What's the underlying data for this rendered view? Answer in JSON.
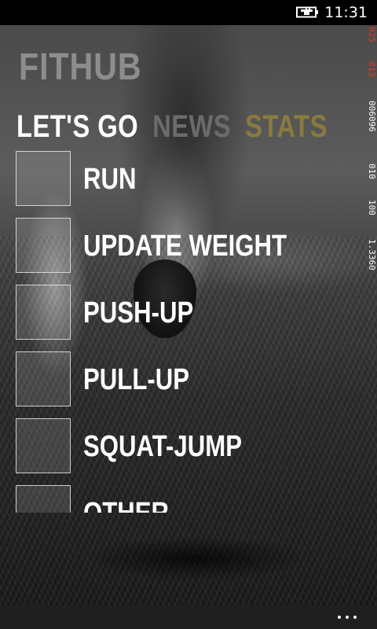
{
  "status_bar": {
    "time": "11:31",
    "battery_icon": "battery-charging-icon"
  },
  "debug_counter": {
    "segments": [
      "025",
      "013",
      "006096",
      "010",
      "100",
      "1.3360"
    ],
    "colors": {
      "highlight": "#e53b1c",
      "normal": "#ffffff"
    }
  },
  "app": {
    "title": "FITHUB"
  },
  "pivot": {
    "tabs": [
      {
        "label": "LET'S GO",
        "state": "active"
      },
      {
        "label": "NEWS",
        "state": "inactive"
      },
      {
        "label": "STATS",
        "state": "inactive"
      }
    ]
  },
  "activities": [
    {
      "label": "RUN"
    },
    {
      "label": "UPDATE WEIGHT"
    },
    {
      "label": "PUSH-UP"
    },
    {
      "label": "PULL-UP"
    },
    {
      "label": "SQUAT-JUMP"
    },
    {
      "label": "OTHER"
    }
  ],
  "app_bar": {
    "more_icon": "more-dots-icon"
  },
  "colors": {
    "title_gray": "#8d8d8d",
    "active_tab": "#ffffff",
    "inactive_tab": "#6b6b6b",
    "stats_tab": "#8a7a3f",
    "app_bar_bg": "#1f1f1f"
  }
}
